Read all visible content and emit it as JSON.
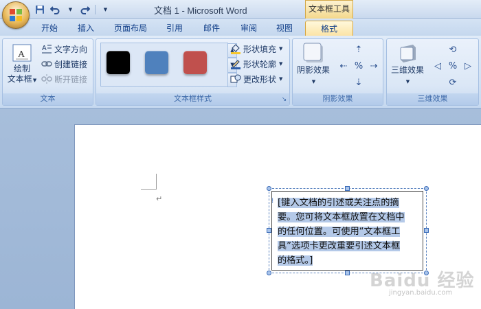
{
  "window": {
    "title": "文档 1 - Microsoft Word",
    "contextual_tools_label": "文本框工具"
  },
  "quick_access": {
    "items": [
      "save-icon",
      "undo-icon",
      "redo-icon",
      "customize-icon"
    ]
  },
  "tabs": [
    {
      "label": "开始"
    },
    {
      "label": "插入"
    },
    {
      "label": "页面布局"
    },
    {
      "label": "引用"
    },
    {
      "label": "邮件"
    },
    {
      "label": "审阅"
    },
    {
      "label": "视图"
    },
    {
      "label": "格式",
      "active": true
    }
  ],
  "ribbon": {
    "text_group": {
      "label": "文本",
      "draw_textbox_line1": "绘制",
      "draw_textbox_line2": "文本框",
      "text_direction": "文字方向",
      "create_link": "创建链接",
      "break_link": "断开链接"
    },
    "textbox_styles": {
      "label": "文本框样式",
      "swatches": [
        "#000000",
        "#4f81bd",
        "#c0504d"
      ],
      "shape_fill": "形状填充",
      "shape_outline": "形状轮廓",
      "change_shape": "更改形状"
    },
    "shadow_effects": {
      "label": "阴影效果",
      "button": "阴影效果"
    },
    "three_d_effects": {
      "label": "三维效果",
      "button": "三维效果"
    }
  },
  "document": {
    "textbox_lines": [
      "[键入文档的引述或关注点的摘",
      "要。您可将文本框放置在文档中",
      "的任何位置。可使用“文本框工",
      "具”选项卡更改重要引述文本框",
      "的格式。]"
    ]
  },
  "watermark": {
    "brand": "Baidu 经验",
    "url": "jingyan.baidu.com"
  }
}
